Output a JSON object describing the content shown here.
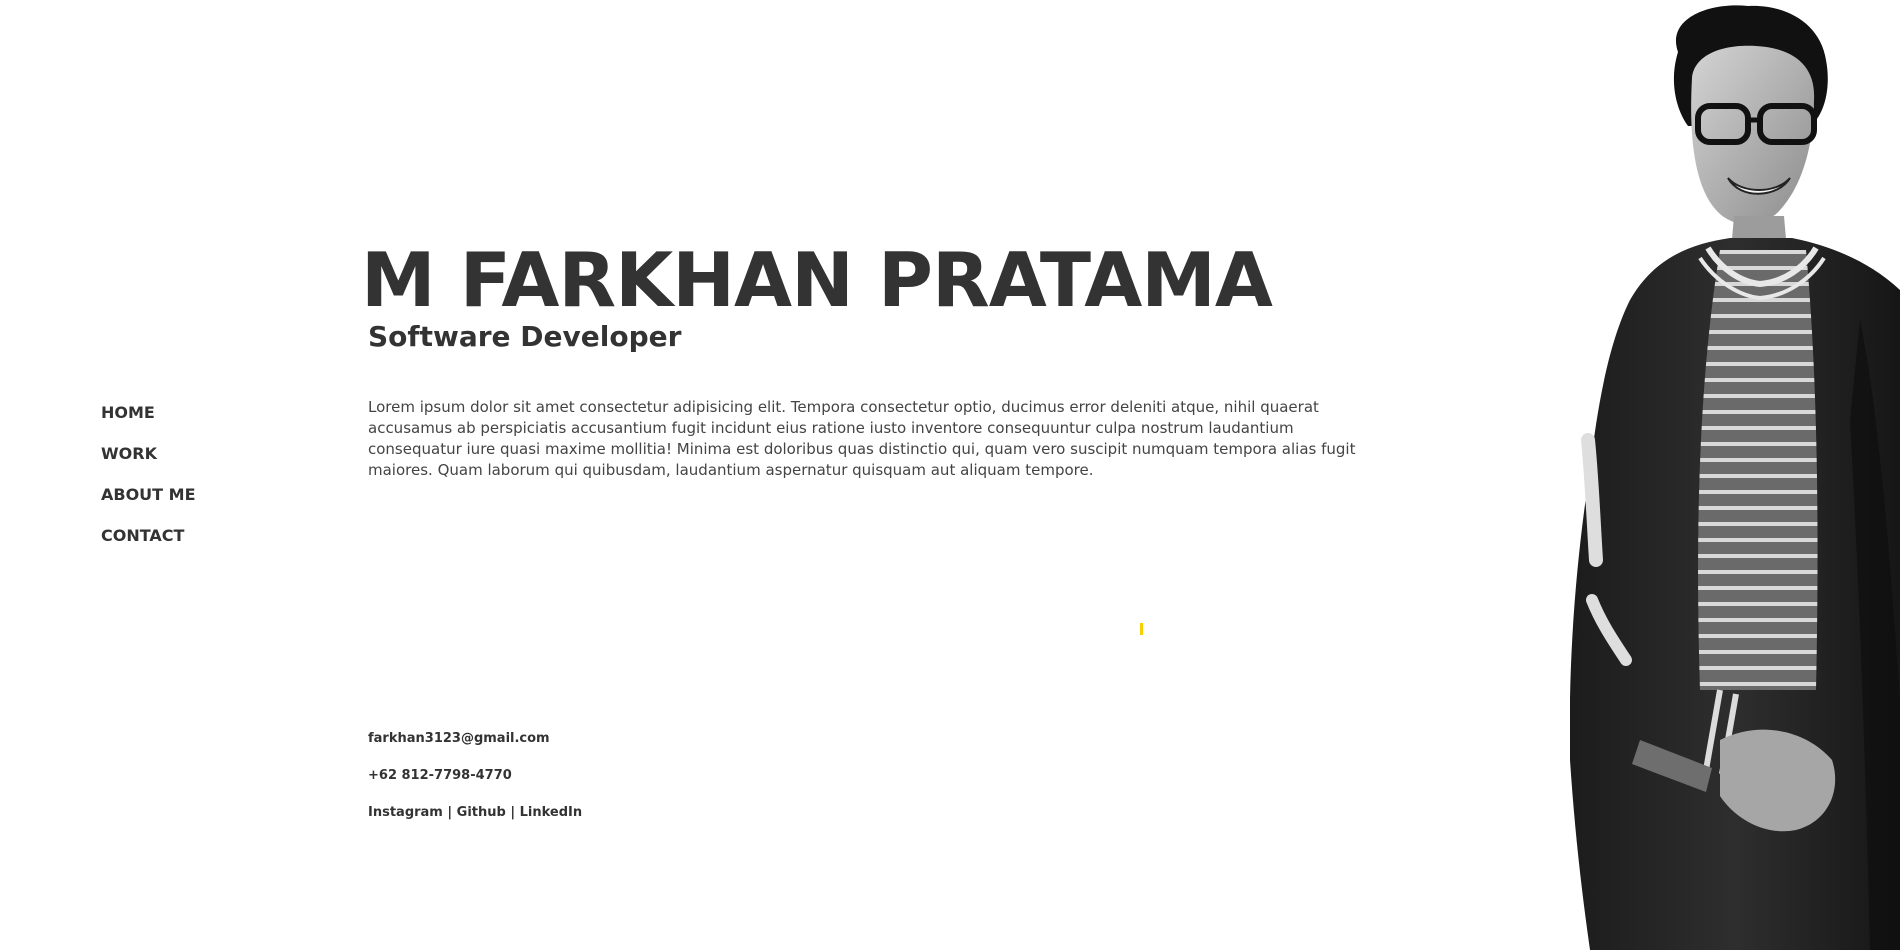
{
  "nav": {
    "items": [
      {
        "label": "HOME"
      },
      {
        "label": "WORK"
      },
      {
        "label": "ABOUT ME"
      },
      {
        "label": "CONTACT"
      }
    ]
  },
  "hero": {
    "name": "M FARKHAN PRATAMA",
    "role": "Software Developer",
    "bio": "Lorem ipsum dolor sit amet consectetur adipisicing elit. Tempora consectetur optio, ducimus error deleniti atque, nihil quaerat accusamus ab perspiciatis accusantium fugit incidunt eius ratione iusto inventore consequuntur culpa nostrum laudantium consequatur iure quasi maxime mollitia! Minima est doloribus quas distinctio qui, quam vero suscipit numquam tempora alias fugit maiores. Quam laborum qui quibusdam, laudantium aspernatur quisquam aut aliquam tempore."
  },
  "contact": {
    "email": "farkhan3123@gmail.com",
    "phone": "+62 812-7798-4770",
    "social": {
      "instagram": "Instagram",
      "separator": " | ",
      "github": "Github",
      "linkedin": "LinkedIn"
    }
  },
  "colors": {
    "text": "#333333",
    "accent": "#f5d100",
    "background": "#ffffff"
  },
  "images": {
    "portrait": "portrait-photo"
  }
}
